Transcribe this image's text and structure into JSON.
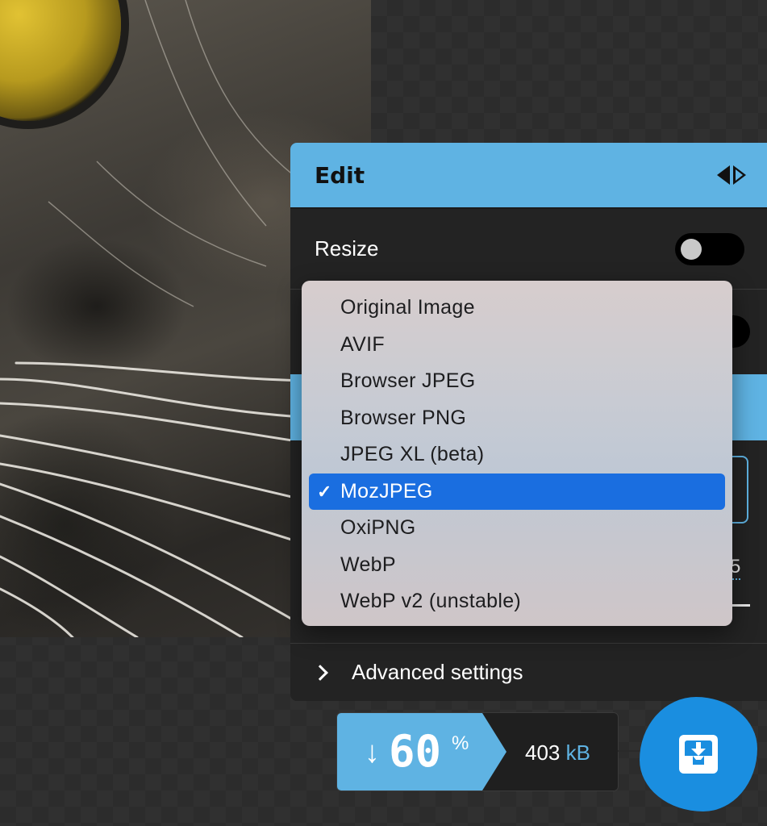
{
  "panel": {
    "title": "Edit",
    "resize_label": "Resize",
    "advanced_label": "Advanced settings",
    "quality_partial": "5"
  },
  "codec_menu": {
    "selected": "MozJPEG",
    "items": [
      "Original Image",
      "AVIF",
      "Browser JPEG",
      "Browser PNG",
      "JPEG XL (beta)",
      "MozJPEG",
      "OxiPNG",
      "WebP",
      "WebP v2 (unstable)"
    ],
    "check_glyph": "✓"
  },
  "results": {
    "arrow": "↓",
    "percent": "60",
    "percent_sign": "%",
    "size": "403",
    "size_unit": "kB"
  },
  "icons": {
    "panel_switch": "side-arrows-icon",
    "download": "download-icon",
    "advanced": "chevron-right-icon"
  },
  "colors": {
    "accent": "#5fb3e3",
    "selection": "#1a6ee0",
    "download": "#1a8ee0",
    "panel_bg": "#232323"
  }
}
